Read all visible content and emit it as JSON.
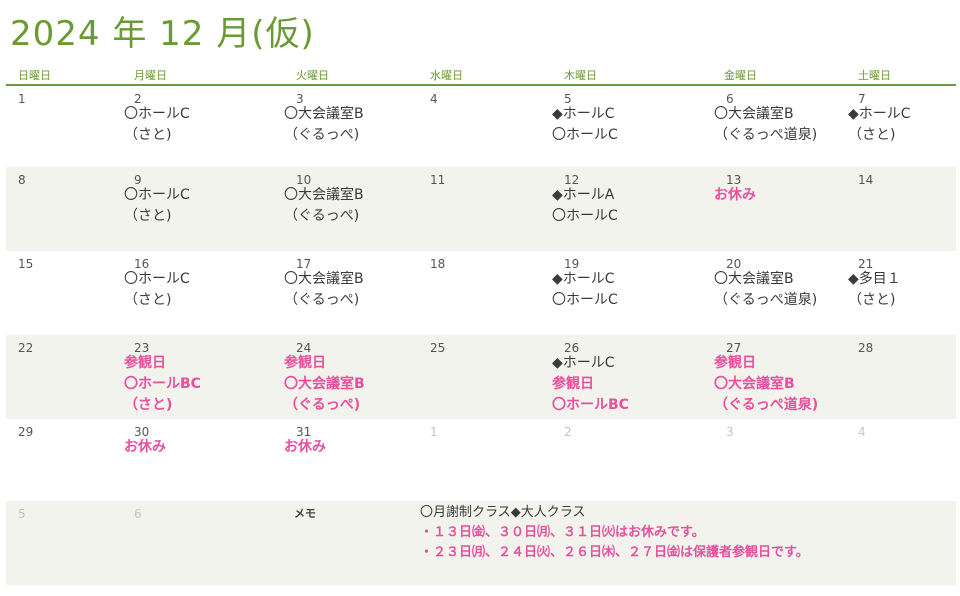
{
  "title": "2024 年 12 月(仮)",
  "weekdays": [
    "日曜日",
    "月曜日",
    "火曜日",
    "水曜日",
    "木曜日",
    "金曜日",
    "土曜日"
  ],
  "weeks": [
    {
      "shaded": false,
      "days": [
        {
          "num": "1",
          "lines": []
        },
        {
          "num": "2",
          "lines": [
            {
              "t": "〇ホールC"
            },
            {
              "t": "（さと)"
            }
          ]
        },
        {
          "num": "3",
          "lines": [
            {
              "t": "〇大会議室B"
            },
            {
              "t": "（ぐるっぺ)"
            }
          ]
        },
        {
          "num": "4",
          "lines": []
        },
        {
          "num": "5",
          "lines": [
            {
              "t": "◆ホールC"
            },
            {
              "t": "〇ホールC"
            }
          ]
        },
        {
          "num": "6",
          "lines": [
            {
              "t": "〇大会議室B"
            },
            {
              "t": "（ぐるっぺ道泉)"
            }
          ]
        },
        {
          "num": "7",
          "lines": [
            {
              "t": "◆ホールC"
            },
            {
              "t": "（さと)"
            }
          ]
        }
      ]
    },
    {
      "shaded": true,
      "days": [
        {
          "num": "8",
          "lines": []
        },
        {
          "num": "9",
          "lines": [
            {
              "t": "〇ホールC"
            },
            {
              "t": "（さと)"
            }
          ]
        },
        {
          "num": "10",
          "lines": [
            {
              "t": "〇大会議室B"
            },
            {
              "t": "（ぐるっぺ)"
            }
          ]
        },
        {
          "num": "11",
          "lines": []
        },
        {
          "num": "12",
          "lines": [
            {
              "t": "◆ホールA"
            },
            {
              "t": "〇ホールC"
            }
          ]
        },
        {
          "num": "13",
          "lines": [
            {
              "t": "お休み",
              "pink": true
            }
          ]
        },
        {
          "num": "14",
          "lines": []
        }
      ]
    },
    {
      "shaded": false,
      "days": [
        {
          "num": "15",
          "lines": []
        },
        {
          "num": "16",
          "lines": [
            {
              "t": "〇ホールC"
            },
            {
              "t": "（さと)"
            }
          ]
        },
        {
          "num": "17",
          "lines": [
            {
              "t": "〇大会議室B"
            },
            {
              "t": "（ぐるっぺ)"
            }
          ]
        },
        {
          "num": "18",
          "lines": []
        },
        {
          "num": "19",
          "lines": [
            {
              "t": "◆ホールC"
            },
            {
              "t": "〇ホールC"
            }
          ]
        },
        {
          "num": "20",
          "lines": [
            {
              "t": "〇大会議室B"
            },
            {
              "t": "（ぐるっぺ道泉)"
            }
          ]
        },
        {
          "num": "21",
          "lines": [
            {
              "t": "◆多目１"
            },
            {
              "t": "（さと)"
            }
          ]
        }
      ]
    },
    {
      "shaded": true,
      "days": [
        {
          "num": "22",
          "lines": []
        },
        {
          "num": "23",
          "lines": [
            {
              "t": "参観日",
              "pink": true
            },
            {
              "t": "〇ホールBC",
              "pink": true
            },
            {
              "t": "（さと)",
              "pink": true
            }
          ]
        },
        {
          "num": "24",
          "lines": [
            {
              "t": "参観日",
              "pink": true
            },
            {
              "t": "〇大会議室B",
              "pink": true
            },
            {
              "t": "（ぐるっぺ)",
              "pink": true
            }
          ]
        },
        {
          "num": "25",
          "lines": []
        },
        {
          "num": "26",
          "lines": [
            {
              "t": "◆ホールC"
            },
            {
              "t": "参観日",
              "pink": true
            },
            {
              "t": "〇ホールBC",
              "pink": true
            }
          ]
        },
        {
          "num": "27",
          "lines": [
            {
              "t": "参観日",
              "pink": true
            },
            {
              "t": "〇大会議室B",
              "pink": true
            },
            {
              "t": "（ぐるっぺ道泉)",
              "pink": true
            }
          ]
        },
        {
          "num": "28",
          "lines": []
        }
      ]
    },
    {
      "shaded": false,
      "days": [
        {
          "num": "29",
          "lines": []
        },
        {
          "num": "30",
          "lines": [
            {
              "t": "お休み",
              "pink": true
            }
          ]
        },
        {
          "num": "31",
          "lines": [
            {
              "t": "お休み",
              "pink": true
            }
          ]
        },
        {
          "num": "1",
          "dim": true,
          "lines": []
        },
        {
          "num": "2",
          "dim": true,
          "lines": []
        },
        {
          "num": "3",
          "dim": true,
          "lines": []
        },
        {
          "num": "4",
          "dim": true,
          "lines": []
        }
      ]
    }
  ],
  "next_week": {
    "sun": "5",
    "mon": "6"
  },
  "memo": {
    "label": "メモ",
    "lines": [
      {
        "t": "〇月謝制クラス◆大人クラス"
      },
      {
        "t": "・１３日㈮、３０日㈪、３１日㈫はお休みです。",
        "pink": true
      },
      {
        "t": "・２３日㈪、２４日㈫、２６日㈭、２７日㈮は保護者参観日です。",
        "pink": true
      }
    ]
  },
  "colors": {
    "accent": "#6a9a33",
    "pink": "#e8509d",
    "shade": "#f1f3ec"
  }
}
